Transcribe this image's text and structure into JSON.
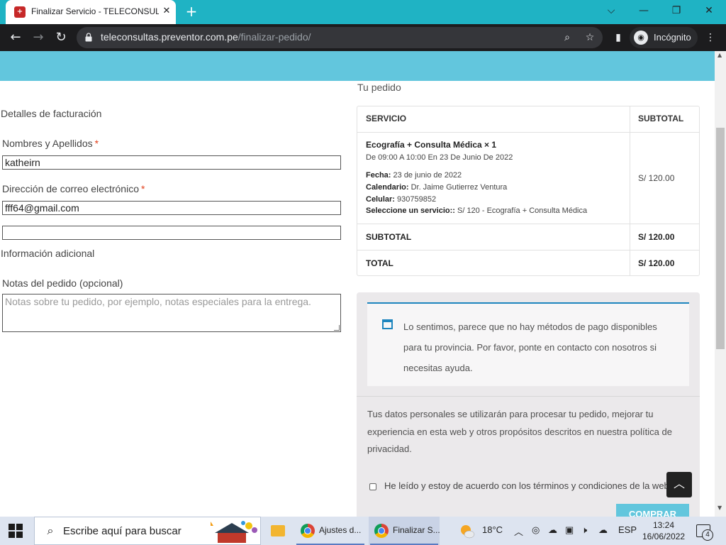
{
  "browser": {
    "tab_title": "Finalizar Servicio - TELECONSULTAS",
    "tab_favicon": "preventor-favicon",
    "url_host": "teleconsultas.preventor.com.pe",
    "url_path": "/finalizar-pedido/",
    "incognito_label": "Incógnito"
  },
  "billing": {
    "heading": "Detalles de facturación",
    "name_label": "Nombres y Apellidos",
    "name_value": "katheirn",
    "email_label": "Dirección de correo electrónico",
    "email_value": "fff64@gmail.com",
    "extra_value": "",
    "required_mark": "*"
  },
  "additional": {
    "heading": "Información adicional",
    "notes_label": "Notas del pedido (opcional)",
    "notes_placeholder": "Notas sobre tu pedido, por ejemplo, notas especiales para la entrega."
  },
  "order": {
    "title": "Tu pedido",
    "col_service": "SERVICIO",
    "col_subtotal": "SUBTOTAL",
    "product_name": "Ecografía + Consulta Médica × 1",
    "product_when": "De 09:00 A 10:00 En 23 De Junio De 2022",
    "meta": [
      {
        "key": "Fecha:",
        "value": " 23 de junio de 2022"
      },
      {
        "key": "Calendario:",
        "value": " Dr. Jaime Gutierrez Ventura"
      },
      {
        "key": "Celular:",
        "value": " 930759852"
      },
      {
        "key": "Seleccione un servicio::",
        "value": " S/ 120 - Ecografía + Consulta Médica"
      }
    ],
    "product_price": "S/ 120.00",
    "subtotal_label": "SUBTOTAL",
    "subtotal_value": "S/ 120.00",
    "total_label": "TOTAL",
    "total_value": "S/ 120.00"
  },
  "payment": {
    "notice": "Lo sentimos, parece que no hay métodos de pago disponibles para tu provincia. Por favor, ponte en contacto con nosotros si necesitas ayuda.",
    "privacy": "Tus datos personales se utilizarán para procesar tu pedido, mejorar tu experiencia en esta web y otros propósitos descritos en nuestra política de privacidad.",
    "terms_label": "He leído y estoy de acuerdo con los términos y condiciones de la web",
    "terms_checked": false,
    "submit_label": "COMPRAR"
  },
  "taskbar": {
    "search_placeholder": "Escribe aquí para buscar",
    "apps": [
      {
        "label": "Ajustes d...",
        "icon": "chrome-icon"
      },
      {
        "label": "Finalizar S...",
        "icon": "chrome-icon"
      }
    ],
    "temperature": "18°C",
    "language": "ESP",
    "time": "13:24",
    "date": "16/06/2022",
    "notifications": "4"
  },
  "colors": {
    "brand": "#62c6dd",
    "tab_strip": "#1fb3c4",
    "notice_accent": "#1e85be"
  }
}
